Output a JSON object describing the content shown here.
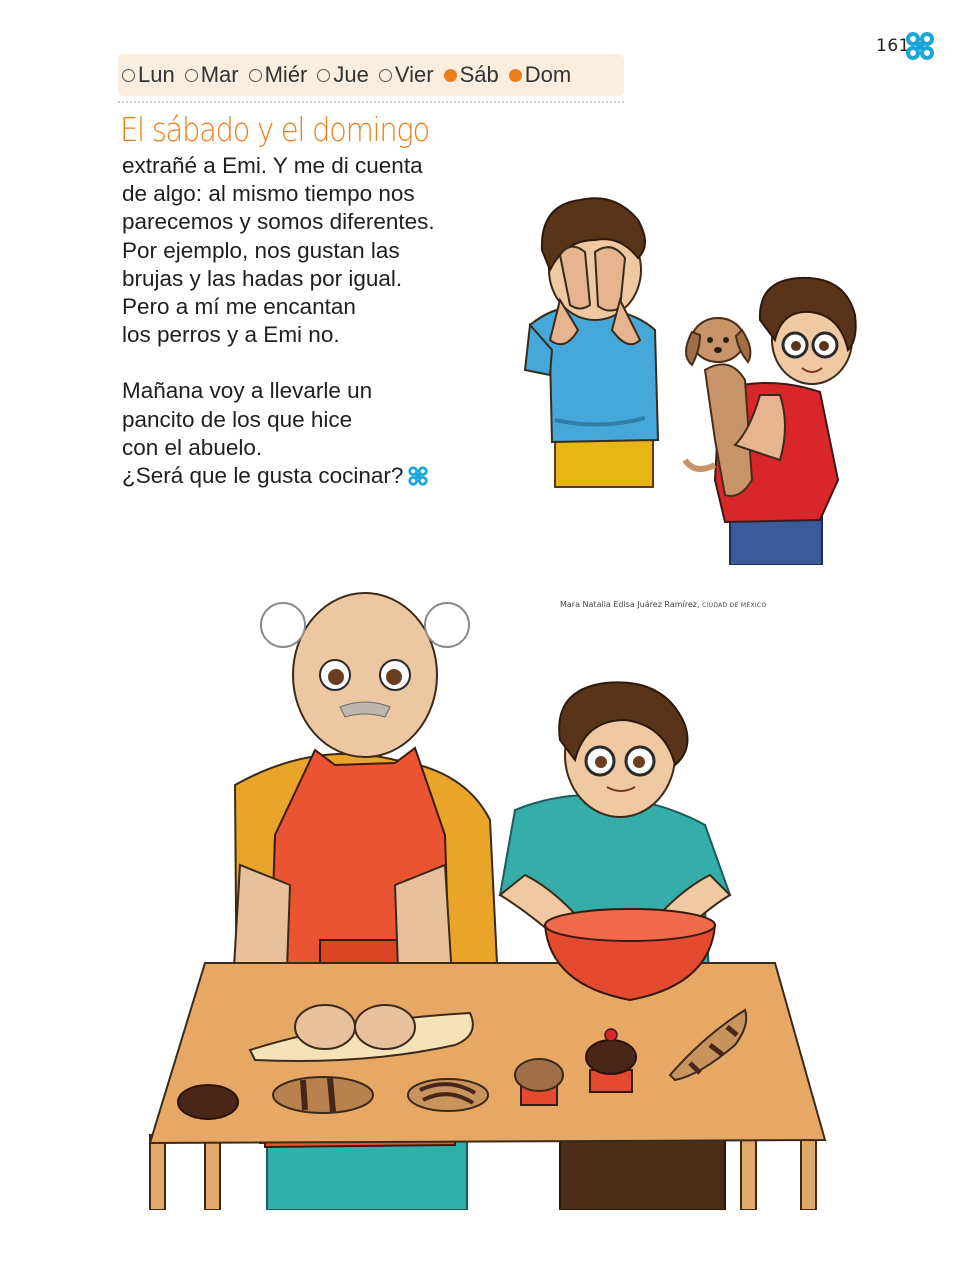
{
  "page": {
    "number": "161"
  },
  "weekdays": [
    {
      "label": "Lun",
      "active": false
    },
    {
      "label": "Mar",
      "active": false
    },
    {
      "label": "Miér",
      "active": false
    },
    {
      "label": "Jue",
      "active": false
    },
    {
      "label": "Vier",
      "active": false
    },
    {
      "label": "Sáb",
      "active": true
    },
    {
      "label": "Dom",
      "active": true
    }
  ],
  "title": "El sábado y el domingo",
  "paragraph1": [
    "extrañé a Emi. Y me di cuenta",
    "de algo: al mismo tiempo nos",
    "parecemos y somos diferentes.",
    "Por ejemplo, nos gustan las",
    "brujas y las hadas por igual.",
    "Pero a mí me encantan",
    "los perros y a Emi no."
  ],
  "paragraph2": [
    "Mañana voy a llevarle un",
    "pancito de los que hice",
    "con el abuelo.",
    "¿Será que le gusta cocinar?"
  ],
  "credit": {
    "name": "Mara Natalia Edisa Juárez Ramírez,",
    "place": "CIUDAD DE MÉXICO"
  },
  "colors": {
    "accent": "#ef7d1a",
    "logo": "#1aa6d9",
    "weekbar_bg": "#fbeede"
  },
  "icons": {
    "corner": "knot-logo-icon",
    "end_mark": "knot-logo-icon"
  }
}
